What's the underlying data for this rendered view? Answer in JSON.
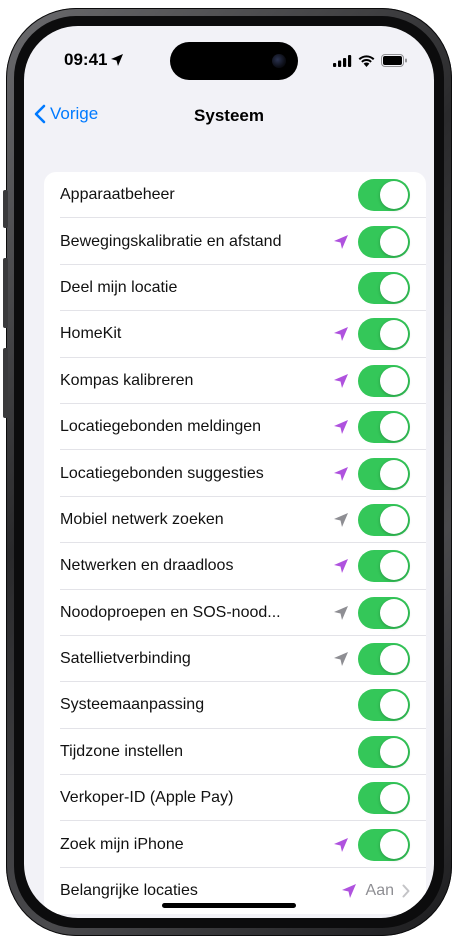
{
  "status": {
    "time": "09:41"
  },
  "nav": {
    "back_label": "Vorige",
    "title": "Systeem"
  },
  "rows": [
    {
      "label": "Apparaatbeheer",
      "location": "none",
      "control": "toggle",
      "on": true
    },
    {
      "label": "Bewegingskalibratie en afstand",
      "location": "purple",
      "control": "toggle",
      "on": true
    },
    {
      "label": "Deel mijn locatie",
      "location": "none",
      "control": "toggle",
      "on": true
    },
    {
      "label": "HomeKit",
      "location": "purple",
      "control": "toggle",
      "on": true
    },
    {
      "label": "Kompas kalibreren",
      "location": "purple",
      "control": "toggle",
      "on": true
    },
    {
      "label": "Locatiegebonden meldingen",
      "location": "purple",
      "control": "toggle",
      "on": true
    },
    {
      "label": "Locatiegebonden suggesties",
      "location": "purple",
      "control": "toggle",
      "on": true
    },
    {
      "label": "Mobiel netwerk zoeken",
      "location": "gray",
      "control": "toggle",
      "on": true
    },
    {
      "label": "Netwerken en draadloos",
      "location": "purple",
      "control": "toggle",
      "on": true
    },
    {
      "label": "Noodoproepen en SOS-nood...",
      "location": "gray",
      "control": "toggle",
      "on": true
    },
    {
      "label": "Satellietverbinding",
      "location": "gray",
      "control": "toggle",
      "on": true
    },
    {
      "label": "Systeemaanpassing",
      "location": "none",
      "control": "toggle",
      "on": true
    },
    {
      "label": "Tijdzone instellen",
      "location": "none",
      "control": "toggle",
      "on": true
    },
    {
      "label": "Verkoper-ID (Apple Pay)",
      "location": "none",
      "control": "toggle",
      "on": true
    },
    {
      "label": "Zoek mijn iPhone",
      "location": "purple",
      "control": "toggle",
      "on": true
    },
    {
      "label": "Belangrijke locaties",
      "location": "purple",
      "control": "detail",
      "detail": "Aan"
    }
  ],
  "colors": {
    "accent": "#007aff",
    "toggle_on": "#34c759",
    "location_purple": "#af52de",
    "location_gray": "#8e8e93"
  },
  "icons": {
    "back": "chevron-left-icon",
    "location": "location-arrow-icon",
    "disclosure": "chevron-right-icon"
  }
}
